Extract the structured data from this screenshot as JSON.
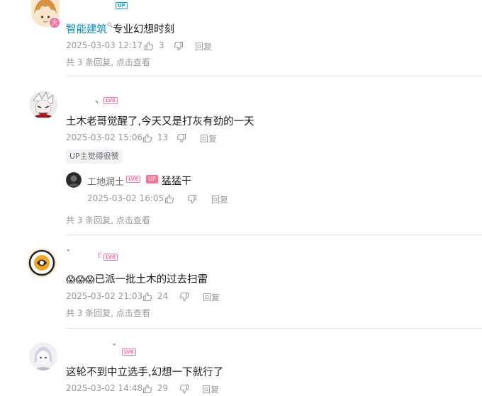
{
  "comments": [
    {
      "avatar_badge": "大",
      "name_tag": "UP",
      "content": {
        "link": "智能建筑",
        "link_icon": "search-icon",
        "text": "专业幻想时刻"
      },
      "time": "2025-03-03 12:17",
      "likes": "3",
      "reply_label": "回复",
      "sub_replies": "共 3 条回复,",
      "sub_replies_action": "点击查看"
    },
    {
      "name": "、",
      "level": "LV6",
      "content": {
        "text": "土木老哥觉醒了,今天又是打灰有劲的一天"
      },
      "time": "2025-03-02 15:06",
      "likes": "13",
      "reply_label": "回复",
      "up_liked": "UP主觉得很赞",
      "reply": {
        "name": "工地润土",
        "level": "LV6",
        "up_badge": "UP",
        "text": "猛猛干",
        "time": "2025-03-02 16:05",
        "reply_label": "回复"
      },
      "sub_replies": "共 3 条回复,",
      "sub_replies_action": "点击查看"
    },
    {
      "name": "ˇ",
      "name_suffix": "ť",
      "level": "LV6",
      "content": {
        "emoji": [
          "😱",
          "😱",
          "😱"
        ],
        "text": "已派一批土木的过去扫雷"
      },
      "time": "2025-03-02 21:03",
      "likes": "24",
      "reply_label": "回复",
      "sub_replies": "共 3 条回复,",
      "sub_replies_action": "点击查看"
    },
    {
      "name": "ˇ",
      "level": "LV6",
      "content": {
        "text": "这轮不到中立选手,幻想一下就行了"
      },
      "time": "2025-03-02 14:48",
      "likes": "29",
      "reply_label": "回复"
    }
  ],
  "colors": {
    "accent_pink": "#fb7299",
    "link_blue": "#008ac5",
    "meta_gray": "#9499a0"
  }
}
